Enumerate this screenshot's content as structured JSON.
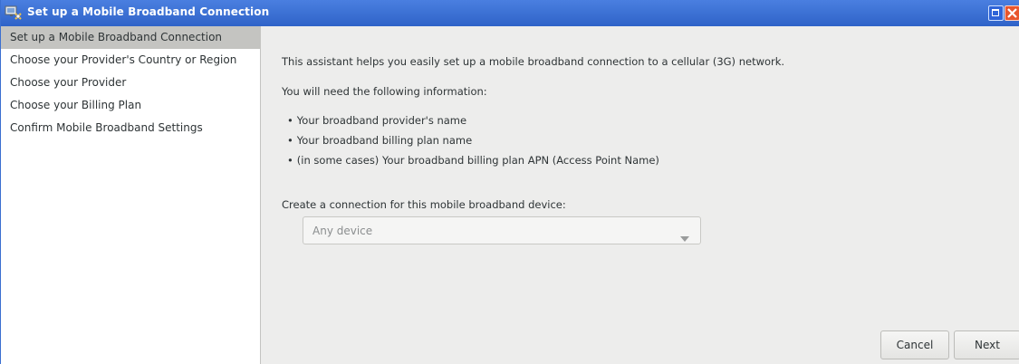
{
  "window": {
    "title": "Set up a Mobile Broadband Connection",
    "app_icon": "network-wizard-icon",
    "maximize_icon": "maximize-icon",
    "close_icon": "close-icon"
  },
  "sidebar": {
    "items": [
      {
        "label": "Set up a Mobile Broadband Connection",
        "active": true
      },
      {
        "label": "Choose your Provider's Country or Region",
        "active": false
      },
      {
        "label": "Choose your Provider",
        "active": false
      },
      {
        "label": "Choose your Billing Plan",
        "active": false
      },
      {
        "label": "Confirm Mobile Broadband Settings",
        "active": false
      }
    ]
  },
  "main": {
    "intro": "This assistant helps you easily set up a mobile broadband connection to a cellular (3G) network.",
    "need_info": "You will need the following information:",
    "bullets": [
      "Your broadband provider's name",
      "Your broadband billing plan name",
      "(in some cases) Your broadband billing plan APN (Access Point Name)"
    ],
    "device_label": "Create a connection for this mobile broadband device:",
    "device_select": {
      "value": "Any device",
      "icon": "chevron-down-icon"
    }
  },
  "buttons": {
    "cancel": "Cancel",
    "next": "Next"
  },
  "colors": {
    "titlebar": "#2f63c8",
    "sidebar_active": "#c4c4c1",
    "content_bg": "#ededec",
    "close_button": "#e8562e"
  }
}
